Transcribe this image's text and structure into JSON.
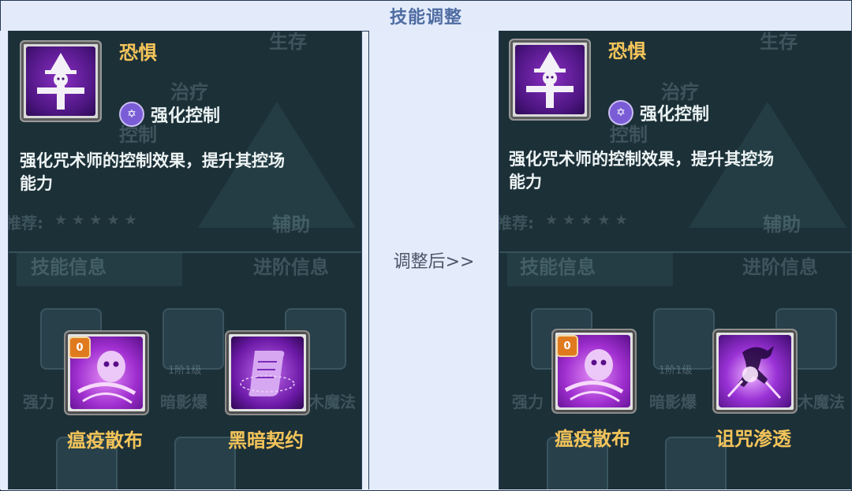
{
  "header": {
    "title": "技能调整"
  },
  "middle": {
    "label": "调整后>>"
  },
  "background": {
    "tabs": [
      "技能信息",
      "进阶信息"
    ],
    "labels": [
      "生存",
      "治疗",
      "控制",
      "辅助",
      "推荐:"
    ],
    "levels": [
      "1阶1级",
      "1阶1级"
    ],
    "skill_fragments": [
      "强力",
      "暗影爆",
      "木魔法"
    ]
  },
  "before": {
    "skill_name": "恐惧",
    "tag": "强化控制",
    "description": "强化咒术师的控制效果，提升其控场能力",
    "description_line1": "强化咒术师的控制效果，提升其控场",
    "description_line2": "能力",
    "subskills": [
      {
        "name": "瘟疫散布",
        "badge": "0"
      },
      {
        "name": "黑暗契约"
      }
    ]
  },
  "after": {
    "skill_name": "恐惧",
    "tag": "强化控制",
    "description_line1": "强化咒术师的控制效果，提升其控场",
    "description_line2": "能力",
    "subskills": [
      {
        "name": "瘟疫散布",
        "badge": "0"
      },
      {
        "name": "诅咒渗透"
      }
    ]
  },
  "colors": {
    "accent_gold": "#f3c45a",
    "panel_bg": "#1c3038",
    "header_text": "#4f6ca2"
  }
}
